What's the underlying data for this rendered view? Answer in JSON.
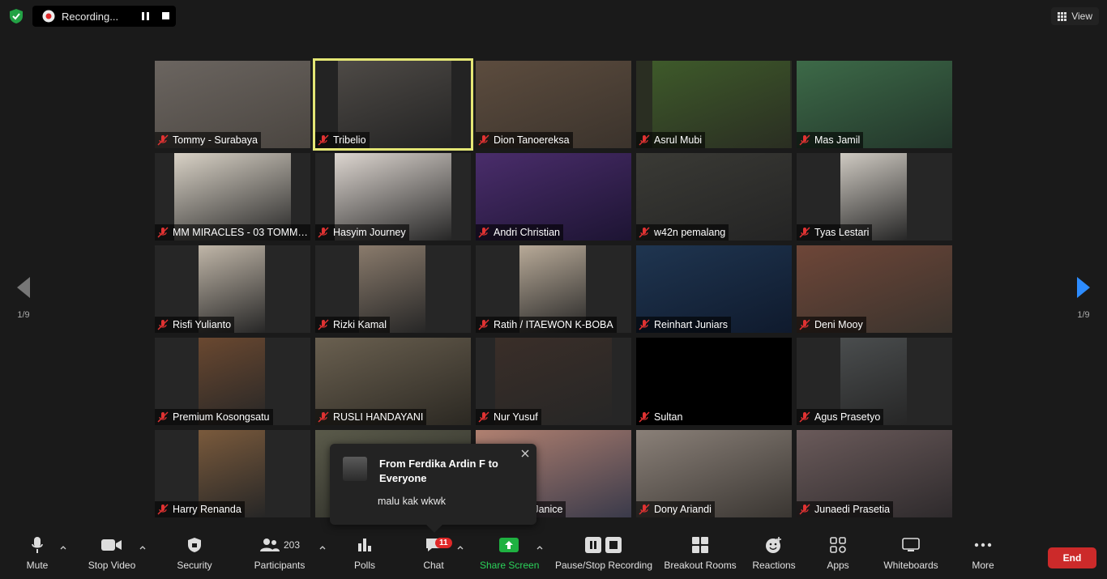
{
  "recording": {
    "label": "Recording..."
  },
  "view": {
    "label": "View"
  },
  "paging": {
    "left": "1/9",
    "right": "1/9"
  },
  "participants": [
    {
      "name": "Tommy - Surabaya",
      "bg": "#4a4540",
      "vid": "#6b6560"
    },
    {
      "name": "Tribelio",
      "bg": "#232323",
      "vid": "#4e4a46"
    },
    {
      "name": "Dion Tanoereksa",
      "bg": "#3b332c",
      "vid": "#5c4c3e"
    },
    {
      "name": "Asrul Mubi",
      "bg": "#2a2e22",
      "vid": "#3e5a2a"
    },
    {
      "name": "Mas Jamil",
      "bg": "#22352a",
      "vid": "#3d6a48"
    },
    {
      "name": "MM MIRACLES - 03 TOMMY...",
      "bg": "#262626",
      "vid": "#d9d2c6"
    },
    {
      "name": "Hasyim Journey",
      "bg": "#262626",
      "vid": "#ddd6d0"
    },
    {
      "name": "Andri Christian",
      "bg": "#1d1433",
      "vid": "#4a2d6b"
    },
    {
      "name": "w42n pemalang",
      "bg": "#242424",
      "vid": "#3a3a35"
    },
    {
      "name": "Tyas Lestari",
      "bg": "#262626",
      "vid": "#cfcac2"
    },
    {
      "name": "Risfi Yulianto",
      "bg": "#262626",
      "vid": "#c0b6a8"
    },
    {
      "name": "Rizki Kamal",
      "bg": "#262626",
      "vid": "#8a7b6c"
    },
    {
      "name": "Ratih / ITAEWON K-BOBA",
      "bg": "#262626",
      "vid": "#b8aa98"
    },
    {
      "name": "Reinhart Juniars",
      "bg": "#0f1a2d",
      "vid": "#1f3550"
    },
    {
      "name": "Deni Mooy",
      "bg": "#3a332d",
      "vid": "#6e4638"
    },
    {
      "name": "Premium Kosongsatu",
      "bg": "#262626",
      "vid": "#6a4830"
    },
    {
      "name": "RUSLI HANDAYANI",
      "bg": "#2b2822",
      "vid": "#6a6050"
    },
    {
      "name": "Nur Yusuf",
      "bg": "#262626",
      "vid": "#3a2e28"
    },
    {
      "name": "Sultan",
      "bg": "#000000",
      "vid": "#000000"
    },
    {
      "name": "Agus Prasetyo",
      "bg": "#262626",
      "vid": "#4a4d4e"
    },
    {
      "name": "Harry Renanda",
      "bg": "#262626",
      "vid": "#7a5a3c"
    },
    {
      "name": "",
      "bg": "#2a2b26",
      "vid": "#5a5a4a"
    },
    {
      "name": "Michelle Janice",
      "bg": "#3a3a4a",
      "vid": "#b08070"
    },
    {
      "name": "Dony Ariandi",
      "bg": "#3a3632",
      "vid": "#8a8078"
    },
    {
      "name": "Junaedi Prasetia",
      "bg": "#2e2a2c",
      "vid": "#6a5a5a"
    }
  ],
  "chat_popup": {
    "from": "From Ferdika Ardin F to Everyone",
    "message": "malu kak wkwk"
  },
  "toolbar": {
    "mute": "Mute",
    "stop_video": "Stop Video",
    "security": "Security",
    "participants": "Participants",
    "participant_count": "203",
    "polls": "Polls",
    "chat": "Chat",
    "chat_badge": "11",
    "share_screen": "Share Screen",
    "pause_stop_recording": "Pause/Stop Recording",
    "breakout_rooms": "Breakout Rooms",
    "reactions": "Reactions",
    "apps": "Apps",
    "whiteboards": "Whiteboards",
    "more": "More",
    "end": "End"
  },
  "colors": {
    "active_speaker": "#e4e675",
    "share_green": "#1fb141",
    "end_red": "#cc2a2a",
    "badge_red": "#e02828"
  }
}
